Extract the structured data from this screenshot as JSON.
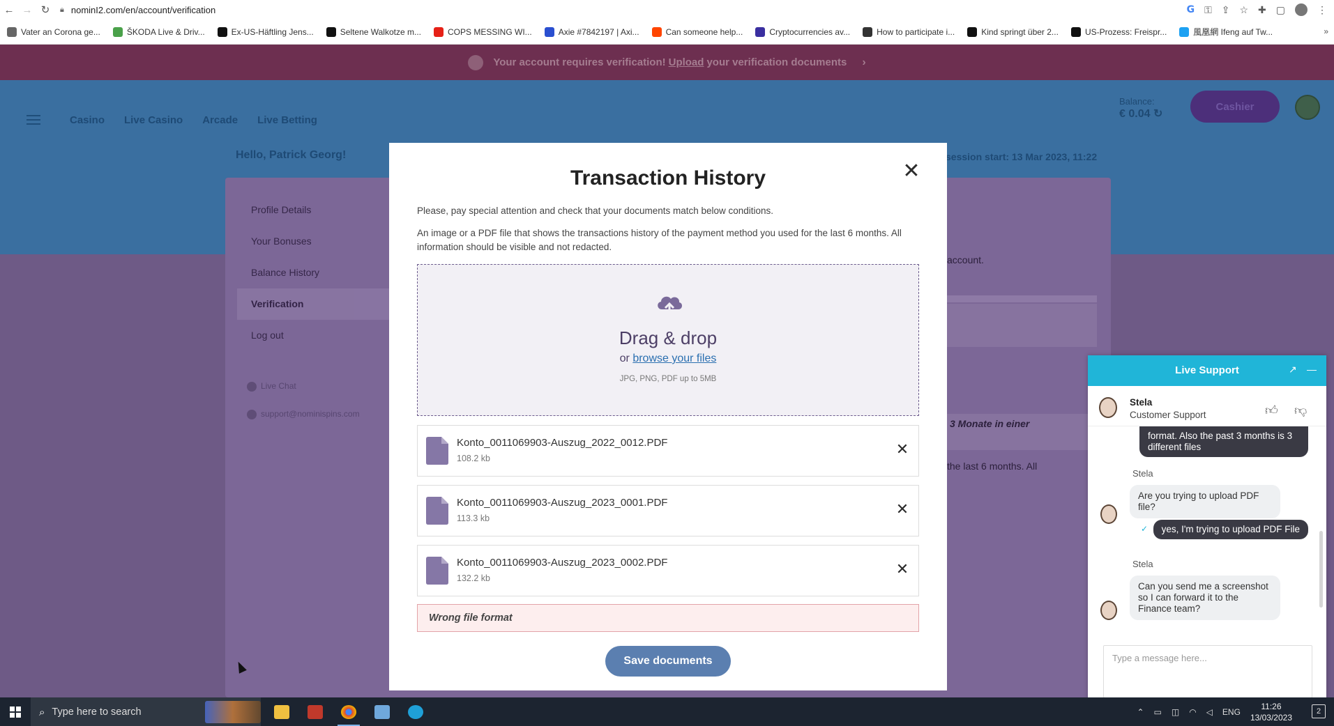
{
  "browser": {
    "url": "nominI2.com/en/account/verification",
    "bookmarks": [
      {
        "label": "Vater an Corona ge...",
        "color": "#666666"
      },
      {
        "label": "ŠKODA Live & Driv...",
        "color": "#4aa14a"
      },
      {
        "label": "Ex-US-Häftling Jens...",
        "color": "#111111"
      },
      {
        "label": "Seltene Walkotze m...",
        "color": "#111111"
      },
      {
        "label": "COPS MESSING WI...",
        "color": "#e62117"
      },
      {
        "label": "Axie #7842197 | Axi...",
        "color": "#2a4fd0"
      },
      {
        "label": "Can someone help...",
        "color": "#ff4500"
      },
      {
        "label": "Cryptocurrencies av...",
        "color": "#3a2fa0"
      },
      {
        "label": "How to participate i...",
        "color": "#333333"
      },
      {
        "label": "Kind springt über 2...",
        "color": "#111111"
      },
      {
        "label": "US-Prozess: Freispr...",
        "color": "#111111"
      },
      {
        "label": "風凰網 Ifeng auf Tw...",
        "color": "#1da1f2"
      }
    ]
  },
  "banner": {
    "pre": "Your account requires verification!",
    "link": "Upload",
    "post": "your verification documents"
  },
  "site": {
    "nav": [
      "Casino",
      "Live Casino",
      "Arcade",
      "Live Betting"
    ],
    "balance_label": "Balance:",
    "balance_value": "€ 0.04",
    "cashier": "Cashier",
    "hello": "Hello, Patrick Georg!",
    "session": "session start: 13 Mar 2023, 11:22"
  },
  "account_menu": {
    "items": [
      "Profile Details",
      "Your Bonuses",
      "Balance History",
      "Verification",
      "Log out"
    ],
    "live_chat": "Live Chat",
    "support_email": "support@nominispins.com"
  },
  "background_text": {
    "account": "account.",
    "monate": "3 Monate in einer",
    "last6": "the last 6 months. All"
  },
  "modal": {
    "title": "Transaction History",
    "intro": "Please, pay special attention and check that your documents match below conditions.",
    "condition": "An image or a PDF file that shows the transactions history of the payment method you used for the last 6 months. All information should be visible and not redacted.",
    "drag_drop": "Drag & drop",
    "or": "or",
    "browse": "browse your files",
    "formats": "JPG, PNG, PDF up to 5MB",
    "files": [
      {
        "name": "Konto_0011069903-Auszug_2022_0012.PDF",
        "size": "108.2 kb"
      },
      {
        "name": "Konto_0011069903-Auszug_2023_0001.PDF",
        "size": "113.3 kb"
      },
      {
        "name": "Konto_0011069903-Auszug_2023_0002.PDF",
        "size": "132.2 kb"
      }
    ],
    "error": "Wrong file format",
    "save": "Save documents"
  },
  "support": {
    "title": "Live Support",
    "agent_name": "Stela",
    "agent_role": "Customer Support",
    "messages": {
      "out1": "format. Also the past 3 months is 3 different files",
      "name1": "Stela",
      "in1": "Are you trying to upload PDF file?",
      "out2": "yes, I'm trying to upload PDF File",
      "name2": "Stela",
      "in2": "Can you send me a screenshot so I can forward it to the Finance team?"
    },
    "input_placeholder": "Type a message here..."
  },
  "taskbar": {
    "search_placeholder": "Type here to search",
    "lang": "ENG",
    "time": "11:26",
    "date": "13/03/2023",
    "notif_count": "2"
  }
}
